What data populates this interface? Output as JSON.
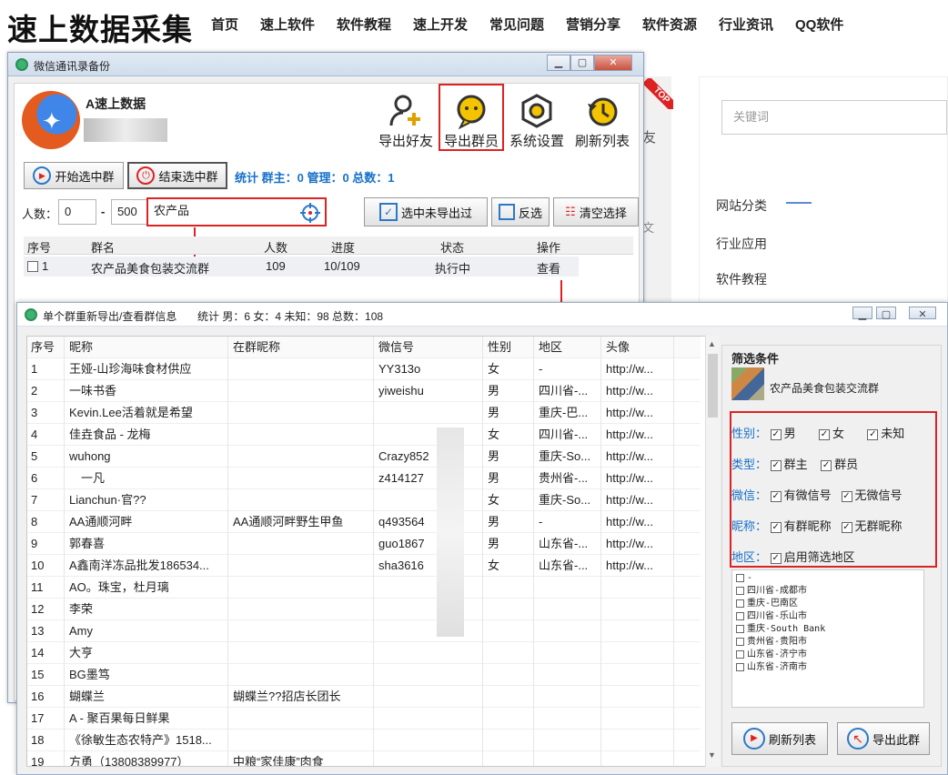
{
  "site": {
    "title": "速上数据采集",
    "nav": [
      "首页",
      "速上软件",
      "软件教程",
      "速上开发",
      "常见问题",
      "营销分享",
      "软件资源",
      "行业资讯",
      "QQ软件"
    ],
    "search_placeholder": "关键词",
    "badge": "TOP",
    "side_links": [
      "网站分类",
      "行业应用",
      "软件教程"
    ],
    "frag1": "友",
    "frag2": "文"
  },
  "w1": {
    "title": "微信通讯录备份",
    "account": "A速上数据",
    "tools": [
      "导出好友",
      "导出群员",
      "系统设置",
      "刷新列表"
    ],
    "btn_start": "开始选中群",
    "btn_end": "结束选中群",
    "stats": "统计 群主：0 管理：0 总数：1",
    "count_label": "人数：",
    "min": "0",
    "dash": "-",
    "max": "500",
    "keyword": "农产品",
    "btn_unexported": "选中未导出过",
    "btn_invert": "反选",
    "btn_clear": "清空选择",
    "headers": [
      "序号",
      "群名",
      "人数",
      "进度",
      "状态",
      "操作"
    ],
    "row": {
      "idx": "1",
      "name": "农产品美食包装交流群",
      "count": "109",
      "progress": "10/109",
      "status": "执行中",
      "op": "查看"
    }
  },
  "w2": {
    "title": "单个群重新导出/查看群信息",
    "stats": "统计 男：6 女：4 未知：98 总数：108",
    "headers": [
      "序号",
      "昵称",
      "在群昵称",
      "微信号",
      "性别",
      "地区",
      "头像"
    ],
    "rows": [
      [
        "1",
        "王娅-山珍海味食材供应",
        "",
        "YY313o",
        "女",
        "-",
        "http://w..."
      ],
      [
        "2",
        "一味书香",
        "",
        "yiweishu",
        "男",
        "四川省-...",
        "http://w..."
      ],
      [
        "3",
        "Kevin.Lee活着就是希望",
        "",
        "",
        "男",
        "重庆-巴...",
        "http://w..."
      ],
      [
        "4",
        "佳垚食品 - 龙梅",
        "",
        "",
        "女",
        "四川省-...",
        "http://w..."
      ],
      [
        "5",
        "wuhong",
        "",
        "Crazy852",
        "男",
        "重庆-So...",
        "http://w..."
      ],
      [
        "6",
        "　一凡",
        "",
        "z414127",
        "男",
        "贵州省-...",
        "http://w..."
      ],
      [
        "7",
        "Lianchun·官??",
        "",
        "",
        "女",
        "重庆-So...",
        "http://w..."
      ],
      [
        "8",
        "AA通顺河畔",
        "AA通顺河畔野生甲鱼",
        "q493564",
        "男",
        "-",
        "http://w..."
      ],
      [
        "9",
        "郭春喜",
        "",
        "guo1867",
        "男",
        "山东省-...",
        "http://w..."
      ],
      [
        "10",
        "A鑫南洋冻品批发186534...",
        "",
        "sha3616",
        "女",
        "山东省-...",
        "http://w..."
      ],
      [
        "11",
        "AO。珠宝，杜月璃",
        "",
        "",
        "",
        "",
        ""
      ],
      [
        "12",
        "李荣",
        "",
        "",
        "",
        "",
        ""
      ],
      [
        "13",
        "Amy",
        "",
        "",
        "",
        "",
        ""
      ],
      [
        "14",
        "大亨",
        "",
        "",
        "",
        "",
        ""
      ],
      [
        "15",
        "BG墨笃",
        "",
        "",
        "",
        "",
        ""
      ],
      [
        "16",
        "蝴蝶兰",
        "蝴蝶兰??招店长团长",
        "",
        "",
        "",
        ""
      ],
      [
        "17",
        "A - 聚百果每日鲜果",
        "",
        "",
        "",
        "",
        ""
      ],
      [
        "18",
        "《徐敏生态农特产》1518...",
        "",
        "",
        "",
        "",
        ""
      ],
      [
        "19",
        "方勇（13808389977）",
        "中粮“家佳康”肉食",
        "",
        "",
        "",
        ""
      ]
    ],
    "filter": {
      "title": "筛选条件",
      "group": "农产品美食包装交流群",
      "gender_label": "性别：",
      "gender": [
        "男",
        "女",
        "未知"
      ],
      "type_label": "类型：",
      "type": [
        "群主",
        "群员"
      ],
      "wx_label": "微信：",
      "wx": [
        "有微信号",
        "无微信号"
      ],
      "nick_label": "昵称：",
      "nick": [
        "有群昵称",
        "无群昵称"
      ],
      "area_label": "地区：",
      "area": "启用筛选地区",
      "regions": [
        "-",
        "四川省-成都市",
        "重庆-巴南区",
        "四川省-乐山市",
        "重庆-South Bank",
        "贵州省-贵阳市",
        "山东省-济宁市",
        "山东省-济南市"
      ],
      "btn_refresh": "刷新列表",
      "btn_export": "导出此群"
    }
  },
  "colors": {
    "accent": "#1670c8",
    "highlight": "#dd2222"
  }
}
